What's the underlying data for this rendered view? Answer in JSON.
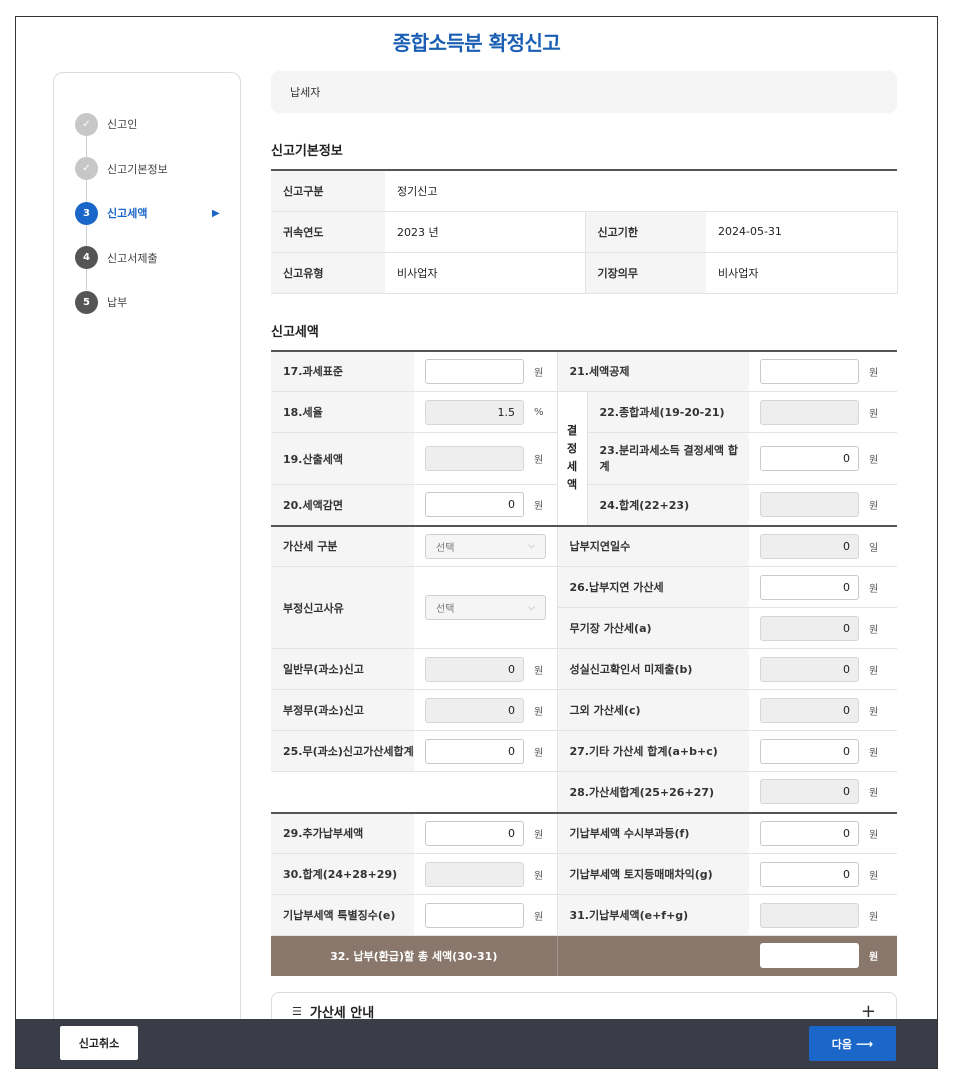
{
  "page_title": "종합소득분 확정신고",
  "steps": [
    {
      "num": "✓",
      "label": "신고인",
      "state": "done"
    },
    {
      "num": "✓",
      "label": "신고기본정보",
      "state": "done"
    },
    {
      "num": "3",
      "label": "신고세액",
      "state": "active"
    },
    {
      "num": "4",
      "label": "신고서제출",
      "state": "todo"
    },
    {
      "num": "5",
      "label": "납부",
      "state": "todo"
    }
  ],
  "taxpayer_label": "납세자",
  "basic_info": {
    "title": "신고기본정보",
    "report_type_label": "신고구분",
    "report_type_value": "정기신고",
    "year_label": "귀속연도",
    "year_value": "2023 년",
    "deadline_label": "신고기한",
    "deadline_value": "2024-05-31",
    "kind_label": "신고유형",
    "kind_value": "비사업자",
    "bookkeeping_label": "기장의무",
    "bookkeeping_value": "비사업자"
  },
  "tax": {
    "title": "신고세액",
    "unit_won": "원",
    "unit_pct": "%",
    "unit_day": "일",
    "r17_label": "17.과세표준",
    "r17_value": "",
    "r21_label": "21.세액공제",
    "r21_value": "",
    "r18_label": "18.세율",
    "r18_value": "1.5",
    "group_label": "결정세액",
    "r22_label": "22.종합과세(19-20-21)",
    "r22_value": "",
    "r19_label": "19.산출세액",
    "r19_value": "",
    "r23_label": "23.분리과세소득 결정세액 합계",
    "r23_value": "0",
    "r20_label": "20.세액감면",
    "r20_value": "0",
    "r24_label": "24.합계(22+23)",
    "r24_value": "",
    "penalty_type_label": "가산세 구분",
    "penalty_type_value": "선택",
    "late_days_label": "납부지연일수",
    "late_days_value": "0",
    "improper_reason_label": "부정신고사유",
    "improper_reason_value": "선택",
    "r26_label": "26.납부지연 가산세",
    "r26_value": "0",
    "no_book_label": "무기장 가산세(a)",
    "no_book_value": "0",
    "general_label": "일반무(과소)신고",
    "general_value": "0",
    "sincerity_label": "성실신고확인서 미제출(b)",
    "sincerity_value": "0",
    "improper_label": "부정무(과소)신고",
    "improper_value": "0",
    "other_label": "그외 가산세(c)",
    "other_value": "0",
    "r25_label": "25.무(과소)신고가산세합계",
    "r25_value": "0",
    "r27_label": "27.기타 가산세 합계(a+b+c)",
    "r27_value": "0",
    "r28_label": "28.가산세합계(25+26+27)",
    "r28_value": "0",
    "r29_label": "29.추가납부세액",
    "r29_value": "0",
    "paid_f_label": "기납부세액 수시부과등(f)",
    "paid_f_value": "0",
    "r30_label": "30.합계(24+28+29)",
    "r30_value": "",
    "paid_g_label": "기납부세액 토지등매매차익(g)",
    "paid_g_value": "0",
    "paid_e_label": "기납부세액 특별징수(e)",
    "paid_e_value": "",
    "r31_label": "31.기납부세액(e+f+g)",
    "r31_value": "",
    "r32_label": "32. 납부(환급)할 총 세액(30-31)",
    "r32_value": ""
  },
  "notice_title": "가산세 안내",
  "footer": {
    "cancel_label": "신고취소",
    "next_label": "다음"
  },
  "colors": {
    "accent": "#1b66c9",
    "total_row": "#8a776c",
    "footer_bg": "#3a3d48"
  }
}
